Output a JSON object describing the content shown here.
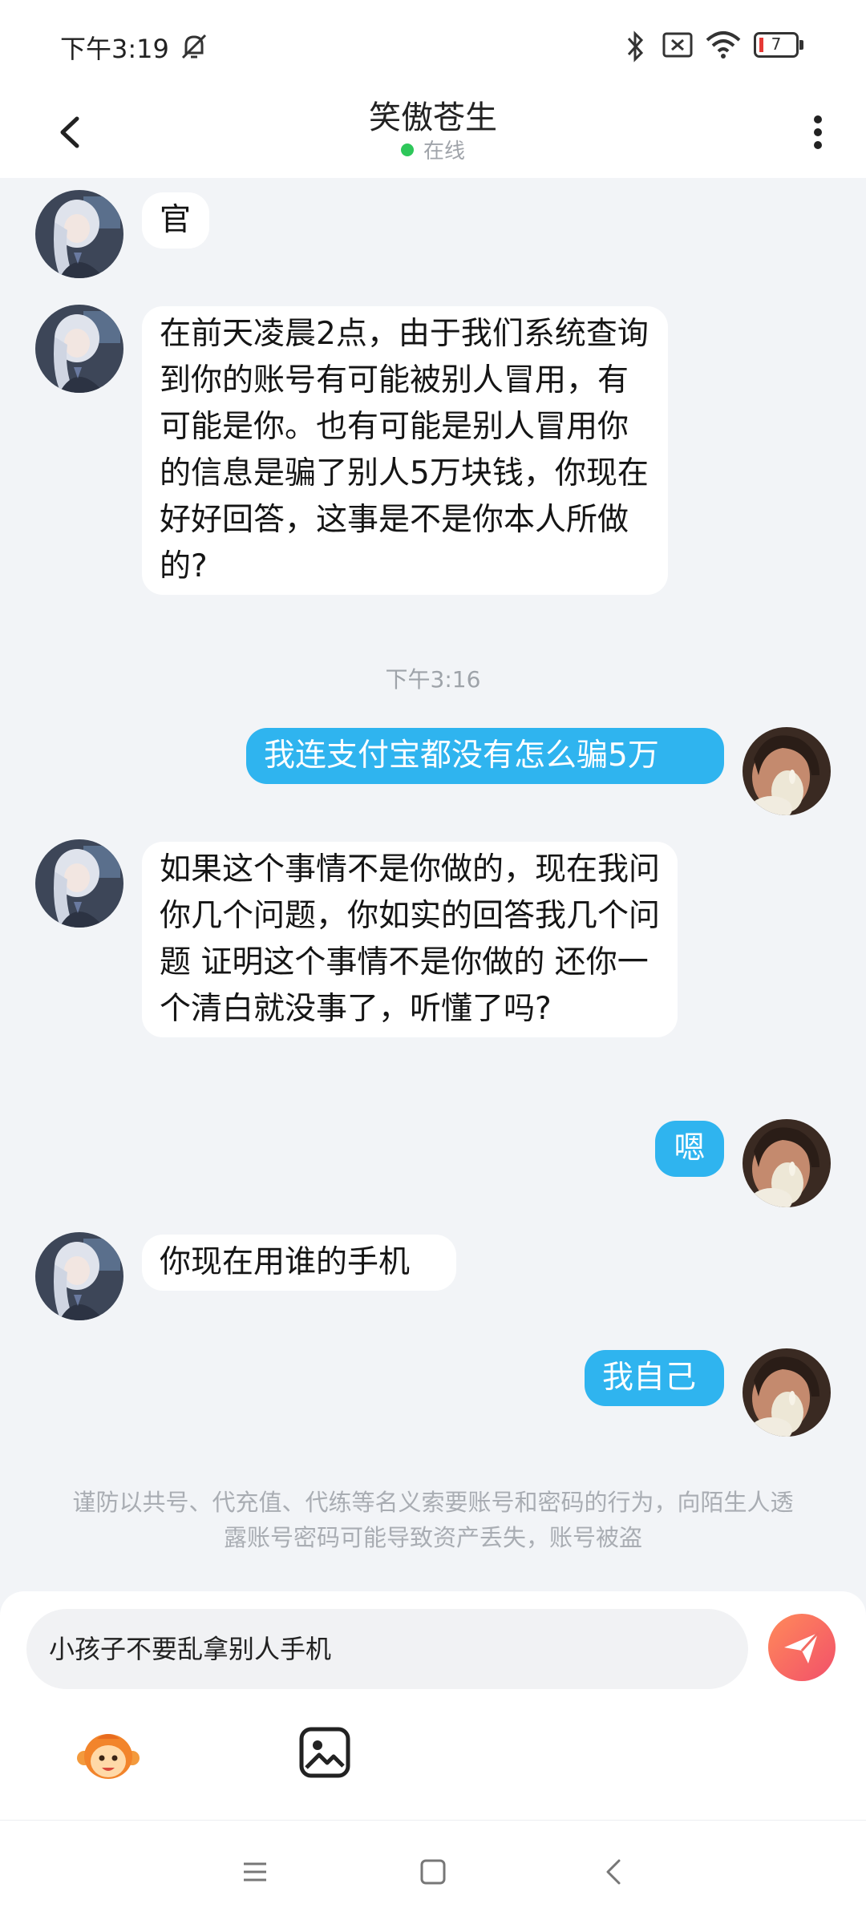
{
  "status_bar": {
    "time": "下午3:19",
    "battery": "7",
    "icons": [
      "mute-bell-icon",
      "bluetooth-icon",
      "no-sim-icon",
      "wifi-icon",
      "battery-icon"
    ]
  },
  "header": {
    "title": "笑傲苍生",
    "status": "在线",
    "status_color": "#2ec75a"
  },
  "messages": [
    {
      "side": "left",
      "text": "官"
    },
    {
      "side": "left",
      "text": "在前天凌晨2点，由于我们系统查询到你的账号有可能被别人冒用，有可能是你。也有可能是别人冒用你的信息是骗了别人5万块钱，你现在好好回答，这事是不是你本人所做的?"
    },
    {
      "side": "right",
      "text": "我连支付宝都没有怎么骗5万"
    },
    {
      "side": "left",
      "text": "如果这个事情不是你做的，现在我问你几个问题，你如实的回答我几个问题 证明这个事情不是你做的 还你一个清白就没事了，听懂了吗?"
    },
    {
      "side": "right",
      "text": "嗯"
    },
    {
      "side": "left",
      "text": "你现在用谁的手机"
    },
    {
      "side": "right",
      "text": "我自己"
    }
  ],
  "timestamp": "下午3:16",
  "warning": "谨防以共号、代充值、代练等名义索要账号和密码的行为，向陌生人透露账号密码可能导致资产丢失，账号被盗",
  "composer": {
    "input_value": "小孩子不要乱拿别人手机",
    "send_icon": "paper-plane-icon",
    "emoji_icon": "monkey-emoji-icon",
    "image_icon": "image-icon"
  },
  "colors": {
    "accent": "#2fb4ef",
    "background": "#f2f4f7",
    "send_gradient": [
      "#ff8a5a",
      "#f2506a"
    ]
  },
  "navbar": [
    "menu-icon",
    "home-square-icon",
    "back-arrow-icon"
  ]
}
